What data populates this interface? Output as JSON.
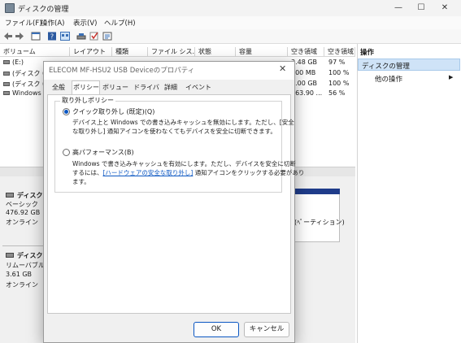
{
  "window": {
    "title": "ディスクの管理",
    "minimize": "—",
    "maximize": "☐",
    "close": "✕"
  },
  "menu": [
    "ファイル(F)",
    "操作(A)",
    "表示(V)",
    "ヘルプ(H)"
  ],
  "volume_table": {
    "headers": [
      "ボリューム",
      "レイアウト",
      "種類",
      "ファイル シス...",
      "状態",
      "容量",
      "空き領域",
      "空き領域"
    ],
    "rows": [
      {
        "volume": "(E:)",
        "free": "3.48 GB",
        "pct": "97 %"
      },
      {
        "volume": "(ディスク 0",
        "free": "100 MB",
        "pct": "100 %"
      },
      {
        "volume": "(ディスク 0",
        "free": "2.00 GB",
        "pct": "100 %"
      },
      {
        "volume": "Windows",
        "free": "263.90 ...",
        "pct": "56 %"
      }
    ]
  },
  "disks": [
    {
      "title": "ディスク",
      "type": "ベーシック",
      "size": "476.92 GB",
      "status": "オンライン"
    },
    {
      "title": "ディスク",
      "type": "リムーバブル",
      "size": "3.61 GB",
      "status": "オンライン"
    }
  ],
  "partition_label": "(ﾍﾟーティション)",
  "actions": {
    "header": "操作",
    "selected": "ディスクの管理",
    "other": "他の操作",
    "arrow": "▶"
  },
  "dialog": {
    "title": "ELECOM MF-HSU2 USB Deviceのプロパティ",
    "close": "✕",
    "tabs": [
      "全般",
      "ポリシー",
      "ボリューム",
      "ドライバー",
      "詳細",
      "イベント"
    ],
    "group_label": "取り外しポリシー",
    "quick": {
      "label": "クイック取り外し (既定)(Q)",
      "desc1": "デバイス上と Windows での書き込みキャッシュを無効にします。ただし、[安全",
      "desc2": "な取り外し] 通知アイコンを使わなくてもデバイスを安全に切断できます。"
    },
    "perf": {
      "label": "高パフォーマンス(B)",
      "desc1": "Windows で書き込みキャッシュを有効にします。ただし、デバイスを安全に切断",
      "desc2_pre": "するには、",
      "desc2_link": "[ハードウェアの安全な取り外し]",
      "desc2_post": " 通知アイコンをクリックする必要があり",
      "desc3": "ます。"
    },
    "ok": "OK",
    "cancel": "キャンセル"
  }
}
